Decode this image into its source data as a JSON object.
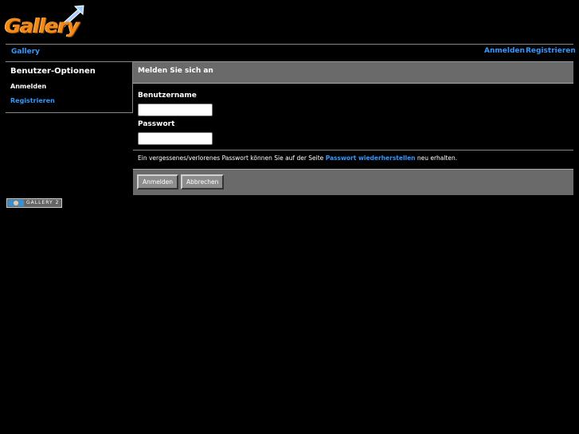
{
  "logo": {
    "text": "Gallery"
  },
  "nav": {
    "breadcrumb": "Gallery",
    "login": "Anmelden",
    "register": "Registrieren"
  },
  "sidebar": {
    "title": "Benutzer-Optionen",
    "items": [
      {
        "label": "Anmelden"
      },
      {
        "label": "Registrieren"
      }
    ]
  },
  "main": {
    "title": "Melden Sie sich an",
    "username_label": "Benutzername",
    "username_value": "",
    "password_label": "Passwort",
    "password_value": "",
    "hint_before": "Ein vergessenes/verlorenes Passwort können Sie auf der Seite ",
    "hint_link": "Passwort wiederherstellen",
    "hint_after": " neu erhalten.",
    "login_button": "Anmelden",
    "cancel_button": "Abbrechen"
  },
  "footer": {
    "badge_text": "GALLERY 2"
  },
  "colors": {
    "accent": "#3399ff",
    "panel": "#6a6a6a",
    "logo": "#f28a1a"
  },
  "icons": {
    "logo": "gallery-logo-icon",
    "badge": "gallery2-badge-icon"
  }
}
